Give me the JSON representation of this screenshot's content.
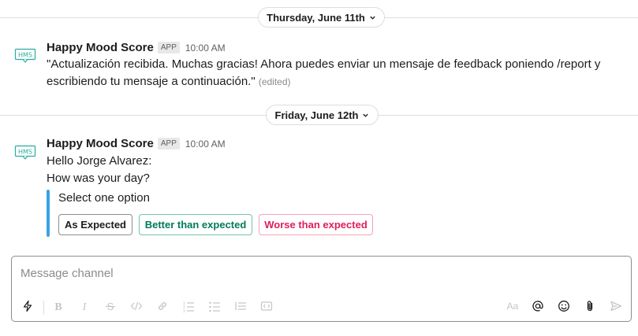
{
  "dates": {
    "first": "Thursday, June 11th",
    "second": "Friday, June 12th"
  },
  "messages": [
    {
      "sender": "Happy Mood Score",
      "badge": "APP",
      "time": "10:00 AM",
      "avatar_text": "HMS",
      "text": "\"Actualización recibida. Muchas gracias! Ahora puedes enviar un mensaje de feedback poniendo /report y escribiendo tu mensaje a continuación.\"",
      "edited": "(edited)"
    },
    {
      "sender": "Happy Mood Score",
      "badge": "APP",
      "time": "10:00 AM",
      "avatar_text": "HMS",
      "line1": "Hello Jorge Alvarez:",
      "line2": "How was your day?",
      "attachment": {
        "label": "Select one option",
        "buttons": [
          {
            "label": "As Expected",
            "color": "#1d1c1d",
            "border": "#8d8d8d"
          },
          {
            "label": "Better than expected",
            "color": "#007a5a",
            "border": "#72c4a8"
          },
          {
            "label": "Worse than expected",
            "color": "#e01e5a",
            "border": "#f3a3bb"
          }
        ]
      }
    }
  ],
  "composer": {
    "placeholder": "Message channel",
    "tools_left": [
      "lightning-icon",
      "bold-icon",
      "italic-icon",
      "strikethrough-icon",
      "code-icon",
      "link-icon",
      "ordered-list-icon",
      "bulleted-list-icon",
      "blockquote-icon",
      "code-block-icon"
    ],
    "tools_right": [
      "formatting-icon",
      "mention-icon",
      "emoji-icon",
      "attach-icon",
      "send-icon"
    ]
  },
  "colors": {
    "accent_bar": "#3aa3e3",
    "avatar": "#2bac9e"
  }
}
